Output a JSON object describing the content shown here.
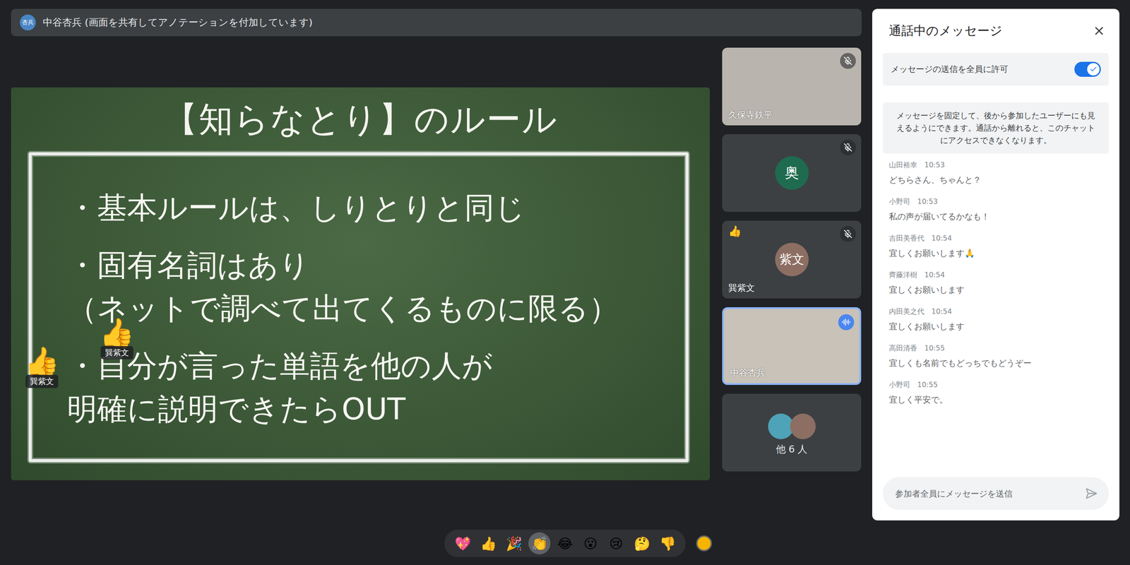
{
  "presenter": {
    "avatar": "杏兵",
    "label": "中谷杏兵 (画面を共有してアノテーションを付加しています)"
  },
  "slide": {
    "title": "【知らなとり】のルール",
    "bullets": [
      {
        "lines": [
          "・基本ルールは、しりとりと同じ"
        ]
      },
      {
        "lines": [
          "・固有名詞はあり",
          "（ネットで調べて出てくるものに限る）"
        ]
      },
      {
        "lines": [
          "・自分が言った単語を他の人が",
          "明確に説明できたらOUT"
        ]
      }
    ]
  },
  "annotations": [
    {
      "emoji": "👍",
      "author": "巽紫文"
    },
    {
      "emoji": "👍",
      "author": "巽紫文"
    }
  ],
  "tiles": [
    {
      "kind": "video",
      "name": "久保寺鉄平",
      "muted": true,
      "speaking": false,
      "selected": false,
      "color": "#b9b5ae"
    },
    {
      "kind": "avatar",
      "initial": "奥",
      "name": "",
      "muted": true,
      "speaking": false,
      "selected": false,
      "color": "#1f6b4f"
    },
    {
      "kind": "avatar",
      "initial": "紫文",
      "name": "巽紫文",
      "muted": true,
      "speaking": false,
      "selected": false,
      "color": "#8d6e63",
      "reaction": "👍"
    },
    {
      "kind": "video",
      "name": "中谷杏兵",
      "muted": false,
      "speaking": true,
      "selected": true,
      "color": "#c8c2b8"
    },
    {
      "kind": "group",
      "label": "他 6 人",
      "avatars": [
        {
          "color": "#4fa3b8"
        },
        {
          "color": "#8d6e63"
        }
      ],
      "muted": false,
      "speaking": false,
      "selected": false
    }
  ],
  "chat": {
    "title": "通話中のメッセージ",
    "allowAll": {
      "label": "メッセージの送信を全員に許可",
      "on": true
    },
    "info": "メッセージを固定して、後から参加したユーザーにも見えるようにできます。通話から離れると、このチャットにアクセスできなくなります。",
    "messages": [
      {
        "sender": "山田裕幸",
        "time": "10:53",
        "text": "どちらさん、ちゃんと？"
      },
      {
        "sender": "小野司",
        "time": "10:53",
        "text": "私の声が届いてるかなも！"
      },
      {
        "sender": "吉田美香代",
        "time": "10:54",
        "text": "宜しくお願いします🙏"
      },
      {
        "sender": "齊藤洋樹",
        "time": "10:54",
        "text": "宜しくお願いします"
      },
      {
        "sender": "内田美之代",
        "time": "10:54",
        "text": "宜しくお願いします"
      },
      {
        "sender": "高田清香",
        "time": "10:55",
        "text": "宜しくも名前でもどっちでもどうぞー"
      },
      {
        "sender": "小野司",
        "time": "10:55",
        "text": "宜しく平安で。"
      }
    ],
    "input": {
      "placeholder": "参加者全員にメッセージを送信"
    }
  },
  "reactions": [
    {
      "emoji": "💖",
      "selected": false
    },
    {
      "emoji": "👍",
      "selected": false
    },
    {
      "emoji": "🎉",
      "selected": false
    },
    {
      "emoji": "👏",
      "selected": true
    },
    {
      "emoji": "😂",
      "selected": false
    },
    {
      "emoji": "😮",
      "selected": false
    },
    {
      "emoji": "😢",
      "selected": false
    },
    {
      "emoji": "🤔",
      "selected": false
    },
    {
      "emoji": "👎",
      "selected": false
    }
  ]
}
